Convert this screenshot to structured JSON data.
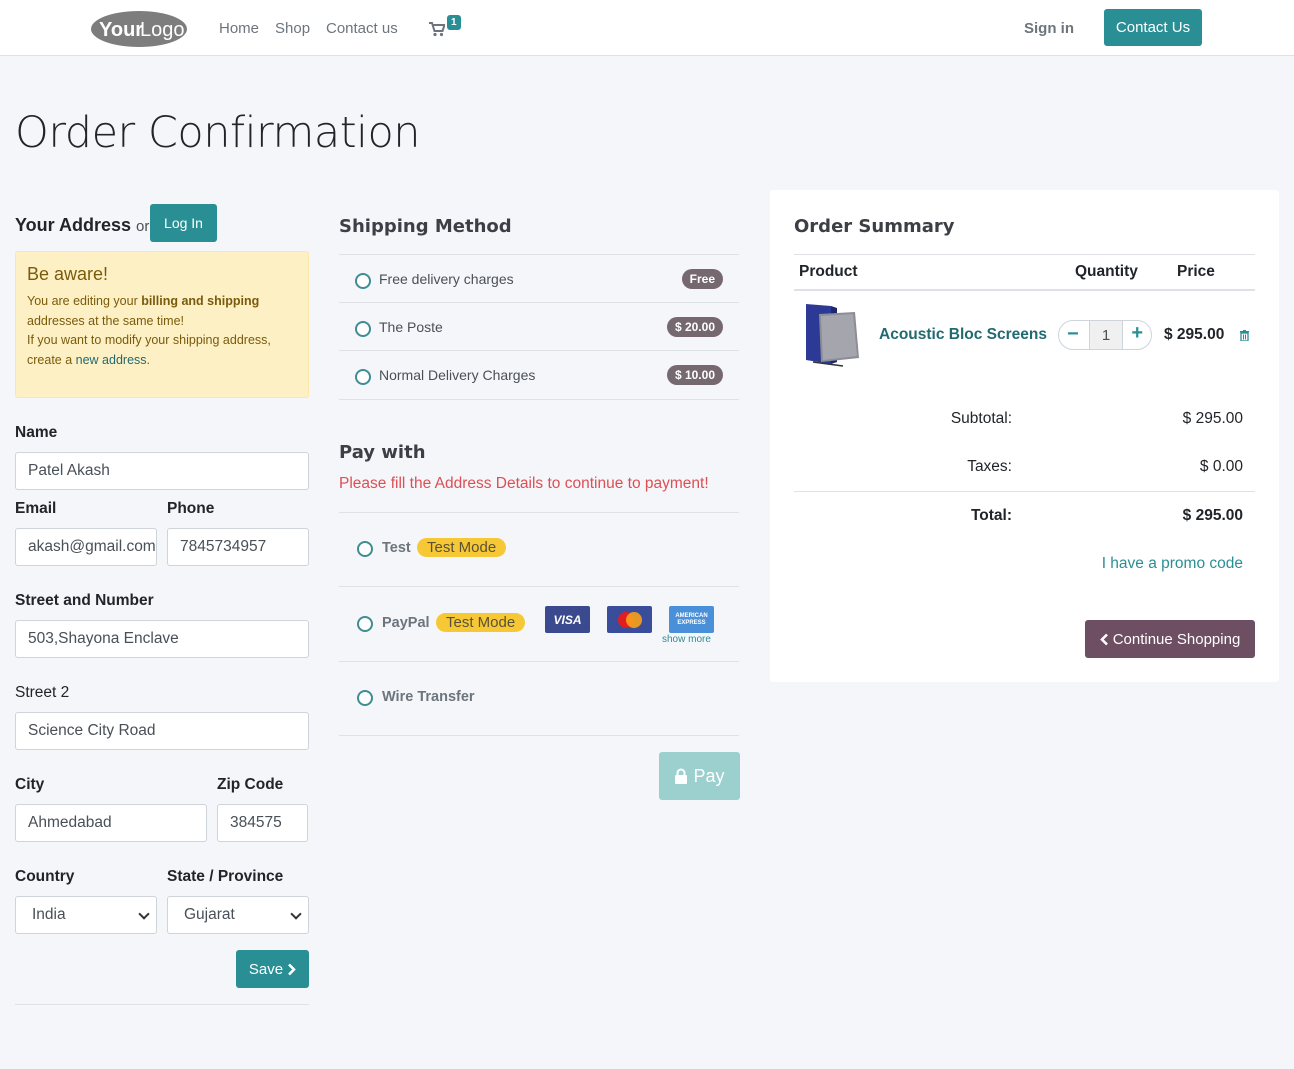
{
  "header": {
    "logo_text": "YourLogo",
    "nav": [
      "Home",
      "Shop",
      "Contact us"
    ],
    "cart_count": "1",
    "signin": "Sign in",
    "contact_button": "Contact Us"
  },
  "page_title": "Order Confirmation",
  "address": {
    "title": "Your Address",
    "or": "or",
    "login_button": "Log In",
    "alert": {
      "title": "Be aware!",
      "line1_pre": "You are editing your ",
      "line1_bold": "billing and shipping",
      "line2": "addresses at the same time!",
      "line3": "If you want to modify your shipping address,",
      "line4_pre": "create a ",
      "line4_link": "new address",
      "line4_post": "."
    },
    "fields": {
      "name_label": "Name",
      "name_value": "Patel Akash",
      "email_label": "Email",
      "email_value": "akash@gmail.com",
      "phone_label": "Phone",
      "phone_value": "7845734957",
      "street_label": "Street and Number",
      "street_value": "503,Shayona Enclave",
      "street2_label": "Street 2",
      "street2_value": "Science City Road",
      "city_label": "City",
      "city_value": "Ahmedabad",
      "zip_label": "Zip Code",
      "zip_value": "384575",
      "country_label": "Country",
      "country_value": "India",
      "state_label": "State / Province",
      "state_value": "Gujarat"
    },
    "save_button": "Save"
  },
  "shipping": {
    "title": "Shipping Method",
    "options": [
      {
        "name": "Free delivery charges",
        "price": "Free"
      },
      {
        "name": "The Poste",
        "price": "$ 20.00"
      },
      {
        "name": "Normal Delivery Charges",
        "price": "$ 10.00"
      }
    ]
  },
  "payment": {
    "title": "Pay with",
    "warning": "Please fill the Address Details to continue to payment!",
    "options": [
      {
        "name": "Test",
        "badge": "Test Mode"
      },
      {
        "name": "PayPal",
        "badge": "Test Mode"
      },
      {
        "name": "Wire Transfer"
      }
    ],
    "cards": [
      "VISA",
      "MasterCard",
      "AMERICAN EXPRESS"
    ],
    "show_more": "show more",
    "pay_button": "Pay"
  },
  "summary": {
    "title": "Order Summary",
    "headers": {
      "product": "Product",
      "quantity": "Quantity",
      "price": "Price"
    },
    "item": {
      "name": "Acoustic Bloc Screens",
      "qty": "1",
      "price": "$ 295.00"
    },
    "subtotal_label": "Subtotal:",
    "subtotal": "$ 295.00",
    "taxes_label": "Taxes:",
    "taxes": "$ 0.00",
    "total_label": "Total:",
    "total": "$ 295.00",
    "promo": "I have a promo code",
    "continue_button": "Continue Shopping"
  },
  "colors": {
    "primary": "#2a8f95",
    "secondary": "#6d4e62",
    "danger": "#dc4f55",
    "warning": "#f7c836"
  }
}
